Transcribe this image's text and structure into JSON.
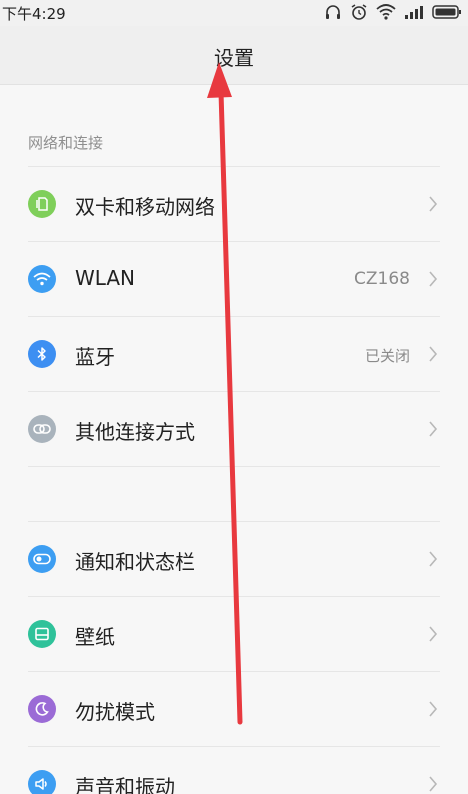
{
  "status_bar": {
    "time": "下午4:29",
    "icons": [
      "headphones-icon",
      "alarm-icon",
      "wifi-icon",
      "signal-icon",
      "battery-icon"
    ]
  },
  "header": {
    "title": "设置"
  },
  "section": {
    "label": "网络和连接"
  },
  "items": [
    {
      "label": "双卡和移动网络",
      "value": "",
      "icon": "sim-card-icon",
      "color": "#7fcf5a"
    },
    {
      "label": "WLAN",
      "value": "CZ168",
      "icon": "wifi-icon",
      "color": "#3d9ef2"
    },
    {
      "label": "蓝牙",
      "value": "已关闭",
      "icon": "bluetooth-icon",
      "color": "#3d8ff2"
    },
    {
      "label": "其他连接方式",
      "value": "",
      "icon": "link-icon",
      "color": "#a9b3bc"
    },
    {
      "label": "通知和状态栏",
      "value": "",
      "icon": "toggle-icon",
      "color": "#3d9ef2"
    },
    {
      "label": "壁纸",
      "value": "",
      "icon": "wallpaper-icon",
      "color": "#2fc29a"
    },
    {
      "label": "勿扰模式",
      "value": "",
      "icon": "moon-icon",
      "color": "#9b6bd6"
    },
    {
      "label": "声音和振动",
      "value": "",
      "icon": "speaker-icon",
      "color": "#3d9ef2"
    }
  ],
  "colors": {
    "annotation_arrow": "#e8393f",
    "background": "#f7f7f7"
  }
}
